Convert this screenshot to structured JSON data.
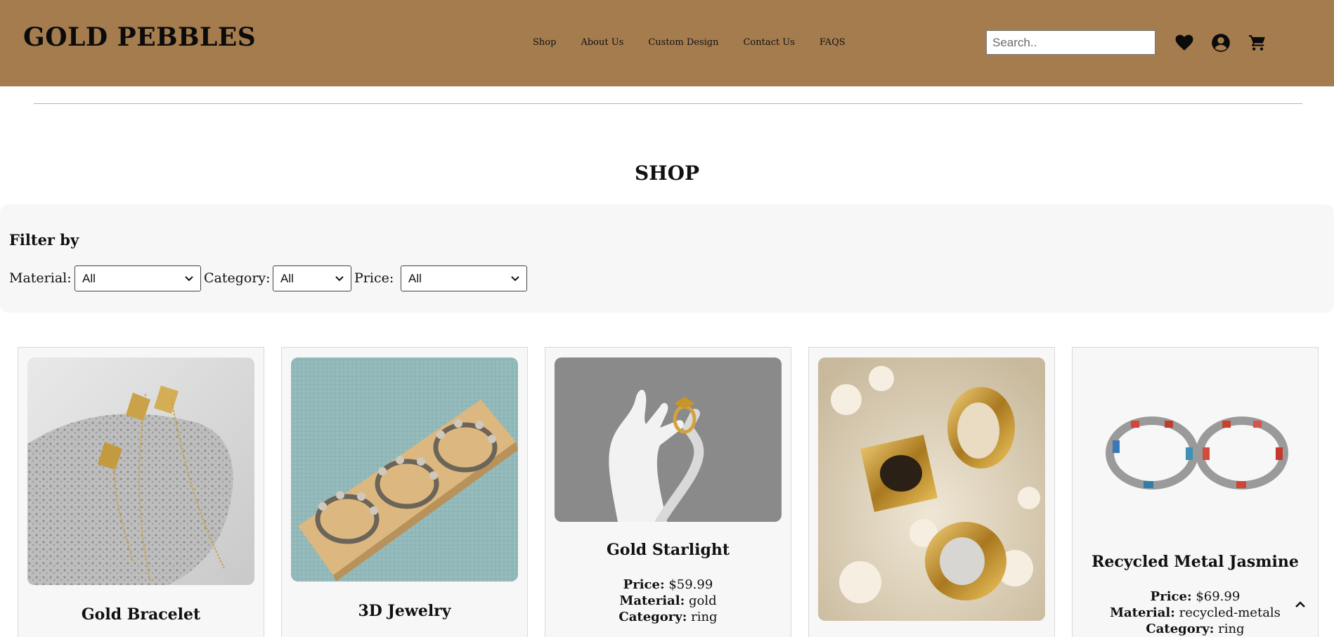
{
  "header": {
    "logo": "GOLD PEBBLES",
    "nav": [
      "Shop",
      "About Us",
      "Custom Design",
      "Contact Us",
      "FAQS"
    ],
    "search_placeholder": "Search..",
    "icons": [
      "heart-icon",
      "user-icon",
      "cart-icon"
    ],
    "bg_color": "#a57c4e"
  },
  "main": {
    "title": "SHOP"
  },
  "filters": {
    "title": "Filter by",
    "material_label": "Material:",
    "material_value": "All",
    "category_label": "Category:",
    "category_value": "All",
    "price_label": "Price:",
    "price_value": "All"
  },
  "products": [
    {
      "name": "Gold Bracelet"
    },
    {
      "name": "3D Jewelry"
    },
    {
      "name": "Gold Starlight",
      "price_label": "Price:",
      "price": "$59.99",
      "material_label": "Material:",
      "material": "gold",
      "category_label": "Category:",
      "category": "ring"
    },
    {
      "name": ""
    },
    {
      "name": "Recycled Metal Jasmine",
      "price_label": "Price:",
      "price": "$69.99",
      "material_label": "Material:",
      "material": "recycled-metals",
      "category_label": "Category:",
      "category": "ring"
    }
  ],
  "back_to_top_icon": "chevron-up-icon"
}
